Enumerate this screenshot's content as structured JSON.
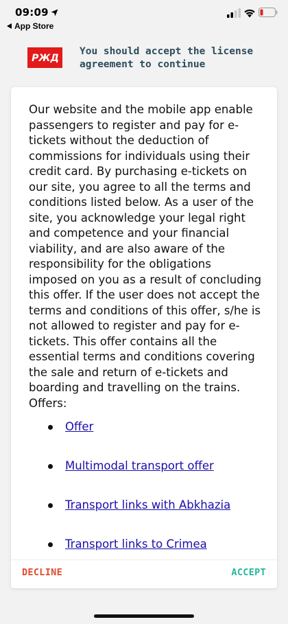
{
  "status_bar": {
    "time": "09:09",
    "back_label": "App Store"
  },
  "header": {
    "logo_text": "РЖД",
    "title": "You should accept the license agreement to continue"
  },
  "agreement": {
    "body": "Our website and the mobile app enable passengers to register and pay for e-tickets without the deduction of commissions for individuals using their credit card. By purchasing e-tickets on our site, you agree to all the terms and conditions listed below. As a user of the site, you acknowledge your legal right and competence and your financial viability, and are also aware of the responsibility for the obligations imposed on you as a result of concluding this offer. If the user does not accept the terms and conditions of this offer, s/he is not allowed to register and pay for e-tickets. This offer contains all the essential terms and conditions covering the sale and return of e-tickets and boarding and travelling on the trains.",
    "offers_label": "Offers:",
    "offers": [
      {
        "label": "Offer"
      },
      {
        "label": "Multimodal transport offer"
      },
      {
        "label": "Transport links with Abkhazia"
      },
      {
        "label": "Transport links to Crimea"
      }
    ]
  },
  "footer": {
    "decline_label": "DECLINE",
    "accept_label": "ACCEPT"
  },
  "colors": {
    "brand_red": "#e21a1a",
    "title_color": "#2d4c5c",
    "decline_color": "#e04b2c",
    "accept_color": "#25b89a",
    "link_color": "#1a0dab"
  }
}
